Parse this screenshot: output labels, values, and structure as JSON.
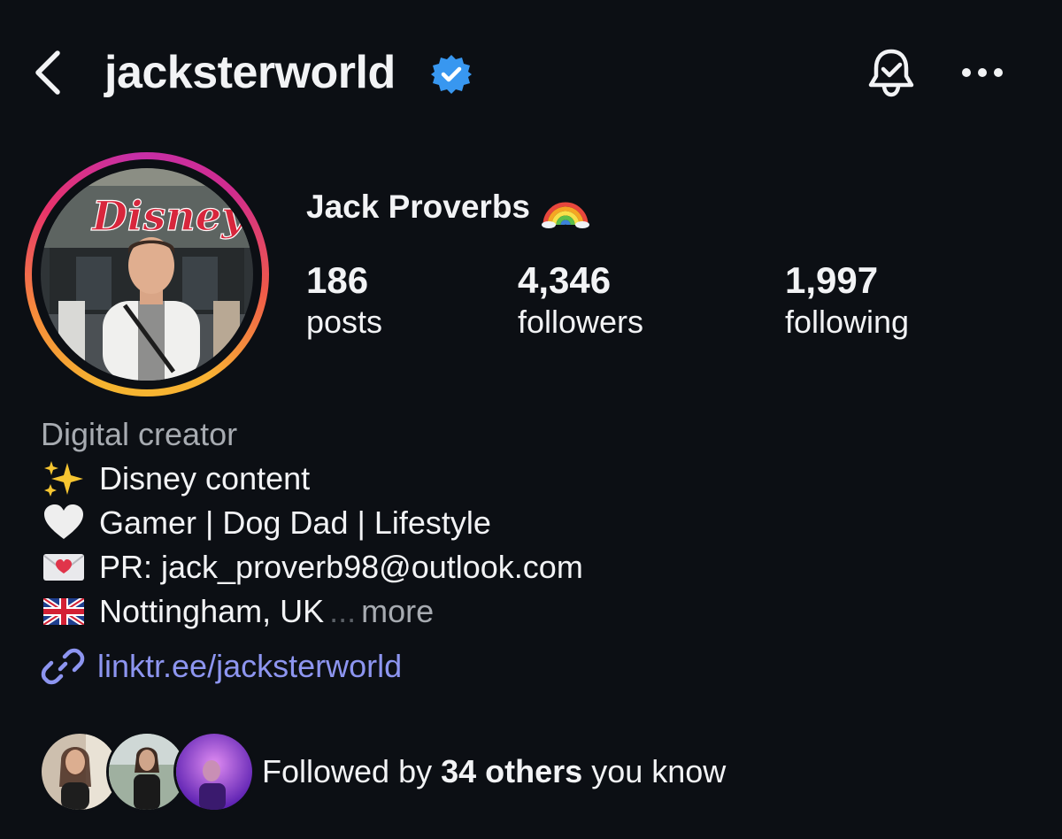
{
  "header": {
    "username": "jacksterworld",
    "verified": true,
    "icons": [
      "back-icon",
      "verified-badge-icon",
      "notification-bell-icon",
      "more-options-icon"
    ]
  },
  "profile": {
    "display_name": "Jack Proverbs",
    "name_emoji": "rainbow-emoji",
    "avatar_sign_text": "Disney",
    "stats": [
      {
        "value": "186",
        "label": "posts"
      },
      {
        "value": "4,346",
        "label": "followers"
      },
      {
        "value": "1,997",
        "label": "following"
      }
    ]
  },
  "bio": {
    "category": "Digital creator",
    "lines": [
      {
        "icon": "sparkles-emoji",
        "text": "Disney content"
      },
      {
        "icon": "white-heart-emoji",
        "text": "Gamer | Dog Dad | Lifestyle"
      },
      {
        "icon": "love-letter-emoji",
        "text": "PR: jack_proverb98@outlook.com"
      },
      {
        "icon": "uk-flag-emoji",
        "text": "Nottingham, UK"
      }
    ],
    "ellipsis": "...",
    "more_label": "more"
  },
  "link": {
    "icon": "link-icon",
    "text": "linktr.ee/jacksterworld",
    "color": "#8d95f0"
  },
  "followed_by": {
    "prefix": "Followed by",
    "count_text": "34 others",
    "suffix": "you know"
  },
  "colors": {
    "background": "#0c0f14",
    "text": "#f2f3f5",
    "muted": "#a7abb1",
    "verified_blue": "#3897f0"
  }
}
